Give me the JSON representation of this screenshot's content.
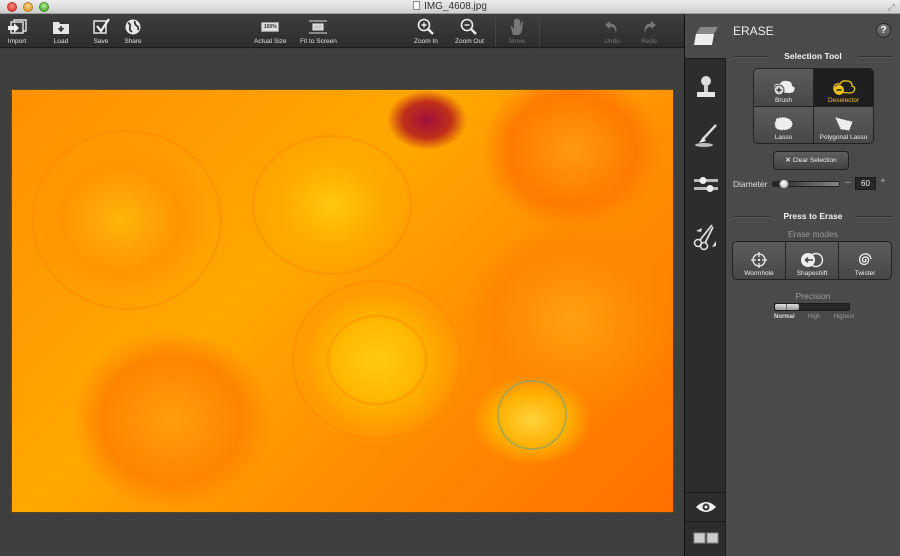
{
  "window": {
    "title": "IMG_4608.jpg"
  },
  "toolbar": {
    "import": "Import",
    "load": "Load",
    "save": "Save",
    "share": "Share",
    "actual_size": "Actual Size",
    "actual_size_badge": "100%",
    "fit_to_screen": "Fit to Screen",
    "zoom_in": "Zoom In",
    "zoom_out": "Zoom Out",
    "move": "Move",
    "undo": "Undo",
    "redo": "Redo"
  },
  "canvas": {
    "image_description": "Close-up photo of orange and yellow ranunculus flowers"
  },
  "toolstrip": {
    "items": [
      "erase",
      "stamp",
      "brush",
      "adjust",
      "cut"
    ],
    "active": "erase",
    "bottom": [
      "preview",
      "compare"
    ]
  },
  "panel": {
    "title": "ERASE",
    "help_label": "?",
    "selection_tool": {
      "heading": "Selection Tool",
      "tools": [
        {
          "label": "Brush",
          "active": false
        },
        {
          "label": "Deselector",
          "active": true
        },
        {
          "label": "Lasso",
          "active": false
        },
        {
          "label": "Polygonal Lasso",
          "active": false
        }
      ],
      "clear_label": "Clear Selection",
      "active_color": "#f0c020"
    },
    "diameter": {
      "label": "Diameter",
      "value": "60",
      "slider_fraction": 0.1,
      "minus": "–",
      "plus": "+"
    },
    "erase": {
      "heading": "Press to Erase",
      "modes_heading": "Erase modes",
      "modes": [
        "Wormhole",
        "Shapeshift",
        "Twister"
      ]
    },
    "precision": {
      "heading": "Precision",
      "levels": [
        "Normal",
        "High",
        "Highest"
      ],
      "selected": "Normal",
      "fraction": 0.33
    }
  }
}
